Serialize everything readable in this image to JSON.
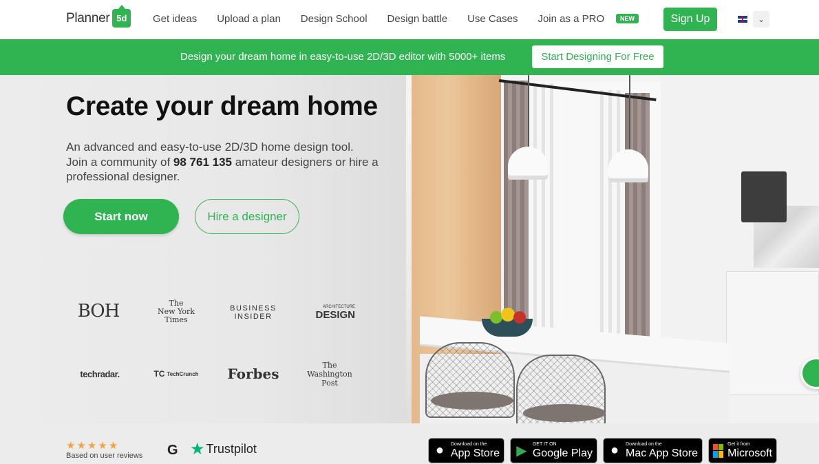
{
  "header": {
    "logo_text": "Planner",
    "logo_badge": "5d",
    "nav": [
      "Get ideas",
      "Upload a plan",
      "Design School",
      "Design battle",
      "Use Cases",
      "Join as a PRO"
    ],
    "new_badge": "NEW",
    "signup_label": "Sign Up",
    "chevron": "⌄"
  },
  "promo": {
    "text": "Design your dream home in easy-to-use 2D/3D editor with 5000+ items",
    "button": "Start Designing For Free"
  },
  "hero": {
    "title": "Create your dream home",
    "desc_line1": "An advanced and easy-to-use 2D/3D home design tool.",
    "desc_line2_pre": "Join a community of ",
    "desc_count": "98 761 135",
    "desc_line2_post": " amateur designers or hire a professional designer.",
    "start_button": "Start now",
    "hire_button": "Hire a designer"
  },
  "press": {
    "boh": "BOH",
    "nyt_line1": "The",
    "nyt_line2": "New York",
    "nyt_line3": "Times",
    "bi_line1": "BUSINESS",
    "bi_line2": "INSIDER",
    "ad_small": "ARCHITECTURE",
    "ad_big": "DESIGN",
    "techradar": "techradar.",
    "techcrunch_mark": "TC",
    "techcrunch": "TechCrunch",
    "forbes": "Forbes",
    "wp_line1": "The",
    "wp_line2": "Washington",
    "wp_line3": "Post"
  },
  "bottom": {
    "stars": "★★★★★",
    "stars_label": "Based on user reviews",
    "g2": "G",
    "trustpilot": "Trustpilot",
    "stores": [
      {
        "small": "Download on the",
        "big": "App Store"
      },
      {
        "small": "GET IT ON",
        "big": "Google Play"
      },
      {
        "small": "Download on the",
        "big": "Mac App Store"
      },
      {
        "small": "Get it from",
        "big": "Microsoft"
      }
    ]
  },
  "colors": {
    "brand_green": "#2fb451",
    "star_orange": "#f2a33a",
    "trustpilot_green": "#00b67a"
  }
}
